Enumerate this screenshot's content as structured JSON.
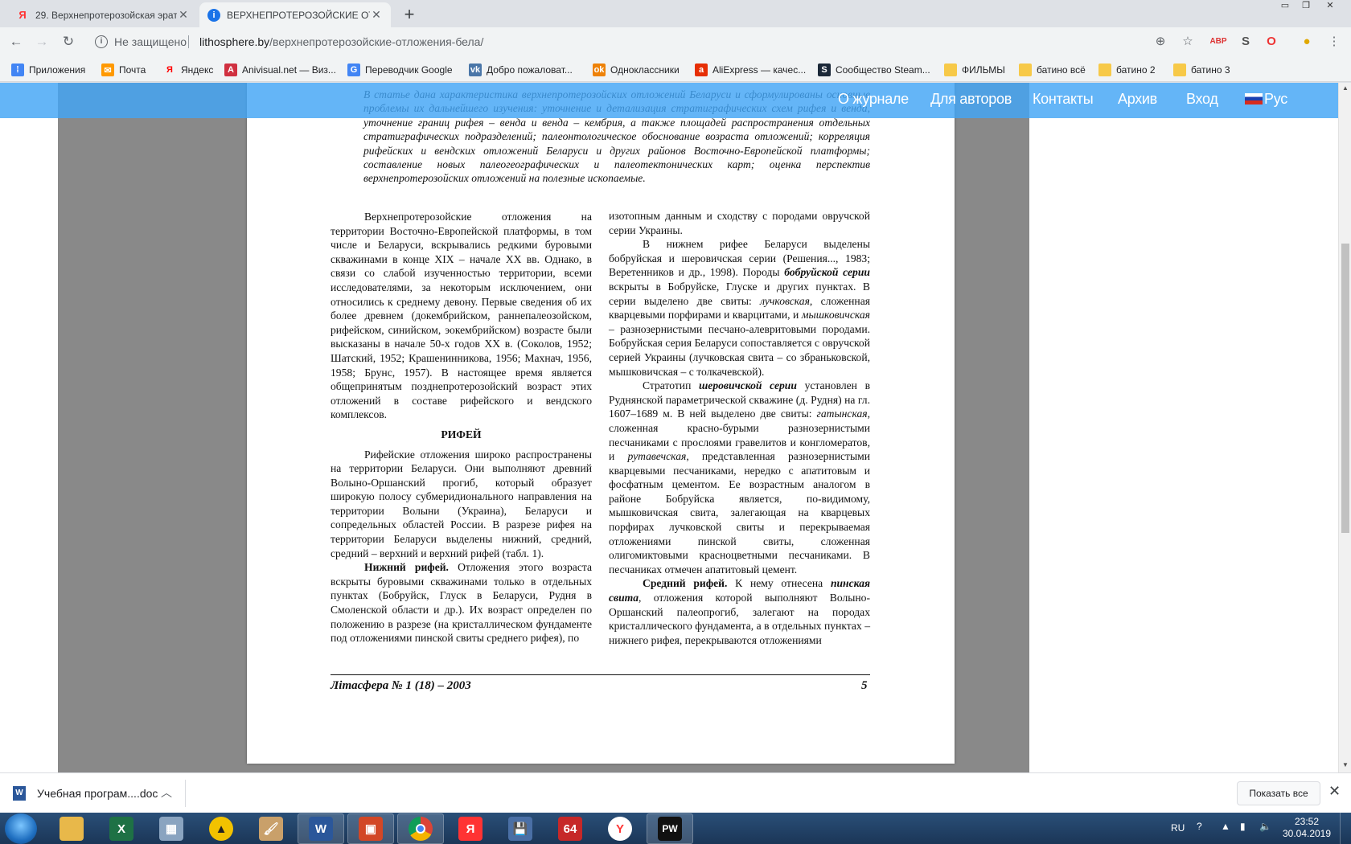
{
  "browser": {
    "tabs": [
      {
        "title": "29. Верхнепротерозойская эрат",
        "favicon": "yandex-icon",
        "active": false
      },
      {
        "title": "ВЕРХНЕПРОТЕРОЗОЙСКИЕ ОТЛ",
        "favicon": "info-icon",
        "active": true
      }
    ],
    "new_tab_label": "+",
    "address_bar": {
      "security_label": "Не защищено",
      "host": "lithosphere.by",
      "path": "/верхнепротерозойские-отложения-бела/"
    },
    "bookmarks": [
      {
        "label": "Приложения",
        "icon": "apps-icon",
        "color": "#4285f4"
      },
      {
        "label": "Почта",
        "icon": "mail-icon",
        "color": "#ff9900"
      },
      {
        "label": "Яндекс",
        "icon": "yandex-icon",
        "color": "#ff0000"
      },
      {
        "label": "Anivisual.net — Виз...",
        "icon": "anivisual-icon",
        "color": "#d03040"
      },
      {
        "label": "Переводчик Google",
        "icon": "translate-icon",
        "color": "#4285f4"
      },
      {
        "label": "Добро пожаловат...",
        "icon": "vk-icon",
        "color": "#4a76a8"
      },
      {
        "label": "Одноклассники",
        "icon": "ok-icon",
        "color": "#ee8208"
      },
      {
        "label": "AliExpress — качес...",
        "icon": "aliexpress-icon",
        "color": "#e62e04"
      },
      {
        "label": "Сообщество Steam...",
        "icon": "steam-icon",
        "color": "#1b2838"
      },
      {
        "label": "ФИЛЬМЫ",
        "icon": "folder-icon",
        "color": "#f7c948"
      },
      {
        "label": "батино всё",
        "icon": "folder-icon",
        "color": "#f7c948"
      },
      {
        "label": "батино 2",
        "icon": "folder-icon",
        "color": "#f7c948"
      },
      {
        "label": "батино 3",
        "icon": "folder-icon",
        "color": "#f7c948"
      }
    ]
  },
  "site_nav": {
    "bg_color": "#42a5f5",
    "items": [
      "О журнале",
      "Для авторов",
      "Контакты",
      "Архив",
      "Вход",
      "Рус"
    ]
  },
  "document": {
    "abstract": "В статье дана характеристика верхнепротерозойских отложений Беларуси и сформулированы основные проблемы их дальнейшего изучения: уточнение и детализация стратиграфических схем рифея и венда, уточнение границ рифея – венда и венда – кембрия, а также площадей распространения отдельных стратиграфических подразделений; палеонтологическое обоснование возраста отложений; корреляция рифейских и вендских отложений Беларуси и других районов Восточно-Европейской платформы; составление новых палеогеографических и палеотектонических карт; оценка перспектив верхнепротерозойских отложений на полезные ископаемые.",
    "left_p1": "Верхнепротерозойские отложения на территории Восточно-Европейской платформы, в том числе и Беларуси, вскрывались редкими буровыми скважинами в конце XIX – начале XX вв. Однако, в связи со слабой изученностью территории, всеми исследователями, за некоторым исключением, они относились к среднему девону. Первые сведения об их более древнем (докембрийском, раннепалеозойском, рифейском, синийском, эокембрийском) возрасте были высказаны в начале 50-х годов XX в. (Соколов, 1952; Шатский, 1952; Крашенинникова, 1956; Махнач, 1956, 1958; Брунс, 1957). В настоящее время является общепринятым позднепротерозойский возраст этих отложений в составе рифейского и вендского комплексов.",
    "heading_riphean": "РИФЕЙ",
    "left_p2": "Рифейские отложения широко распространены на территории Беларуси. Они выполняют древний Волыно-Оршанский прогиб, который образует широкую полосу субмеридионального направления на территории Волыни (Украина), Беларуси и сопредельных областей России. В разрезе рифея на территории Беларуси выделены нижний, средний, средний – верхний и верхний рифей (табл. 1).",
    "left_p3_bold": "Нижний рифей.",
    "left_p3": " Отложения этого возраста вскрыты буровыми скважинами только в отдельных пунктах (Бобруйск, Глуск в Беларуси, Рудня в Смоленской области и др.). Их возраст определен по положению в разрезе (на кристаллическом фундаменте под отложениями пинской свиты среднего рифея), по",
    "right_p0": "изотопным данным и сходству с породами овручской серии Украины.",
    "right_p1_a": "В нижнем рифее Беларуси выделены бобруйская и шеровичская серии (Решения..., 1983; Веретенников и др., 1998). Породы ",
    "right_p1_b": "бобруйской серии",
    "right_p1_c": " вскрыты в Бобруйске, Глуске и других пунктах. В серии выделено две свиты: ",
    "right_p1_d": "лучковская",
    "right_p1_e": ", сложенная кварцевыми порфирами и кварцитами, и ",
    "right_p1_f": "мышковичская",
    "right_p1_g": " – разнозернистыми песчано-алевритовыми породами. Бобруйская серия Беларуси сопоставляется с овручской серией Украины (лучковская свита – со збраньковской, мышковичская – с толкачевской).",
    "right_p2_a": "Стратотип ",
    "right_p2_b": "шеровичской серии",
    "right_p2_c": " установлен в Руднянской параметрической скважине (д. Рудня) на гл. 1607–1689 м. В ней выделено две свиты: ",
    "right_p2_d": "гатынская",
    "right_p2_e": ", сложенная красно-бурыми разнозернистыми песчаниками с прослоями гравелитов и конгломератов, и ",
    "right_p2_f": "рутавечская",
    "right_p2_g": ", представленная разнозернистыми кварцевыми песчаниками, нередко с апатитовым и фосфатным цементом. Ее возрастным аналогом в районе Бобруйска является, по-видимому, мышковичская свита, залегающая на кварцевых порфирах лучковской свиты и перекрываемая отложениями пинской свиты, сложенная олигомиктовыми красноцветными песчаниками. В песчаниках отмечен апатитовый цемент.",
    "right_p3_a": "Средний рифей.",
    "right_p3_b": " К нему отнесена ",
    "right_p3_c": "пинская свита",
    "right_p3_d": ", отложения которой выполняют Волыно-Оршанский палеопрогиб, залегают на породах кристаллического фундамента, а в отдельных пунктах – нижнего рифея, перекрываются отложениями",
    "footer_title": "Літасфера № 1 (18) – 2003",
    "footer_page": "5"
  },
  "downloads": {
    "file_label": "Учебная програм....doc",
    "show_all": "Показать все"
  },
  "taskbar": {
    "lang": "RU",
    "time": "23:52",
    "date": "30.04.2019"
  }
}
